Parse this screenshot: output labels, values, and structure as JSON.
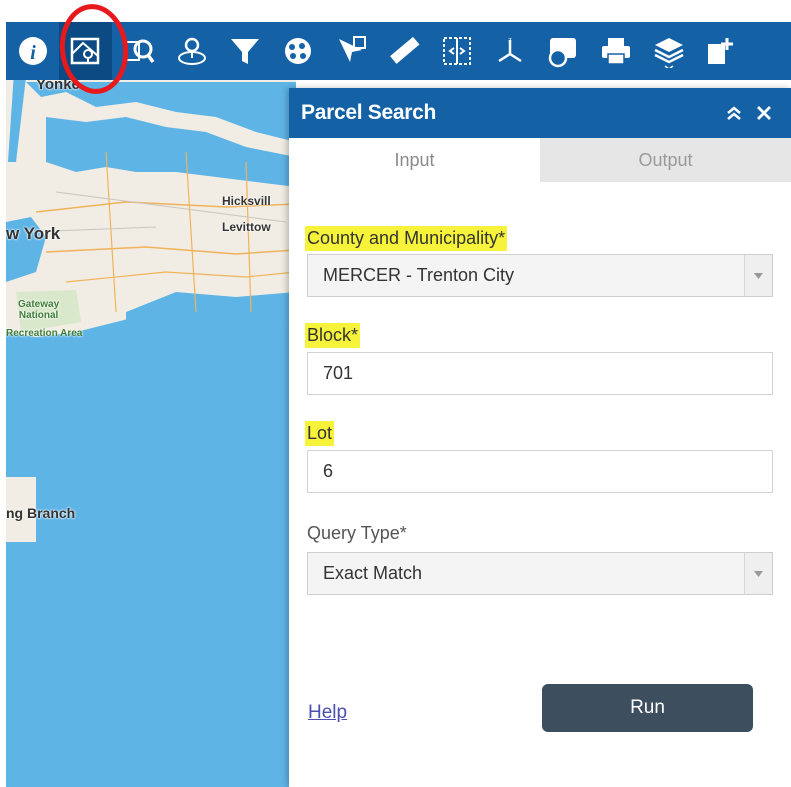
{
  "toolbar": {
    "tools": [
      {
        "icon": "info-icon"
      },
      {
        "icon": "parcel-search-icon",
        "active": true
      },
      {
        "icon": "query-icon"
      },
      {
        "icon": "location-icon"
      },
      {
        "icon": "filter-icon"
      },
      {
        "icon": "pan-select-icon"
      },
      {
        "icon": "select-icon"
      },
      {
        "icon": "measure-icon"
      },
      {
        "icon": "swipe-icon"
      },
      {
        "icon": "coordinate-icon"
      },
      {
        "icon": "layer-list-icon"
      },
      {
        "icon": "print-icon"
      },
      {
        "icon": "add-layer-icon"
      },
      {
        "icon": "add-data-icon"
      }
    ]
  },
  "map": {
    "labels": {
      "yonkers": "Yonke",
      "hicksville": "Hicksvill",
      "levittown": "Levittow",
      "new_york": "w York",
      "gateway": "Gateway",
      "national": "National",
      "recreation": "Recreation Area",
      "long_branch": "ng Branch"
    }
  },
  "panel": {
    "title": "Parcel Search",
    "tabs": {
      "input": "Input",
      "output": "Output"
    },
    "county_label": "County and Municipality*",
    "county_value": "MERCER - Trenton City",
    "block_label": "Block*",
    "block_value": "701",
    "lot_label": "Lot",
    "lot_value": "6",
    "query_type_label": "Query Type*",
    "query_type_value": "Exact Match",
    "help_link": "Help",
    "run_button": "Run"
  },
  "colors": {
    "header_blue": "#1461a6",
    "highlight_yellow": "#f6f33a",
    "run_button": "#3d4e5e",
    "ring_red": "#e8191c"
  }
}
